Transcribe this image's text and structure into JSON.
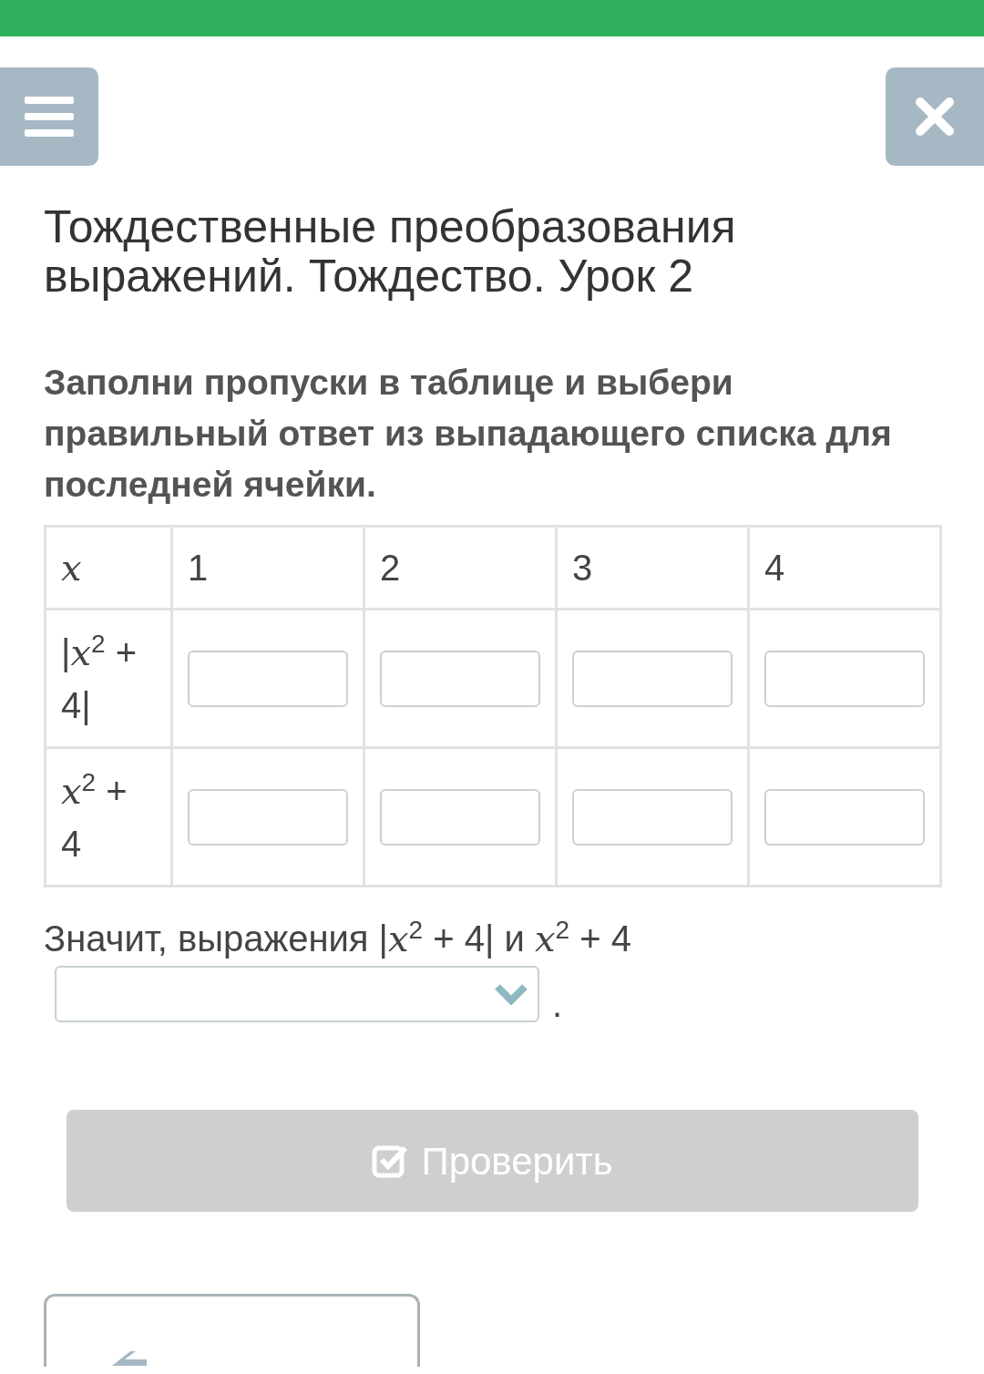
{
  "top_bar": {
    "kind": "accent"
  },
  "title": "Тождественные преобразования выражений. Тождество. Урок 2",
  "instruction": "Заполни пропуски в таблице и выбери правильный ответ из выпадающего списка для последней ячейки.",
  "table": {
    "header_row": [
      "*x*",
      "1",
      "2",
      "3",
      "4"
    ],
    "rows": [
      {
        "label": "|*x*$^{2}$ + 4|",
        "cells": [
          {
            "kind": "input"
          },
          {
            "kind": "input"
          },
          {
            "kind": "input"
          },
          {
            "kind": "input"
          }
        ]
      },
      {
        "label": "*x*$^{2}$ + 4",
        "cells": [
          {
            "kind": "input"
          },
          {
            "kind": "input"
          },
          {
            "kind": "input"
          },
          {
            "kind": "input"
          }
        ]
      }
    ]
  },
  "conclusion": {
    "text": "Значит, выражения |*x*$^{2}$ + 4| и *x*$^{2}$ + 4",
    "dropdown": {
      "kind": "select"
    },
    "end": "."
  },
  "check_button": {
    "label": "Проверить",
    "disabled": true
  },
  "back_button": {
    "kind": "back"
  }
}
